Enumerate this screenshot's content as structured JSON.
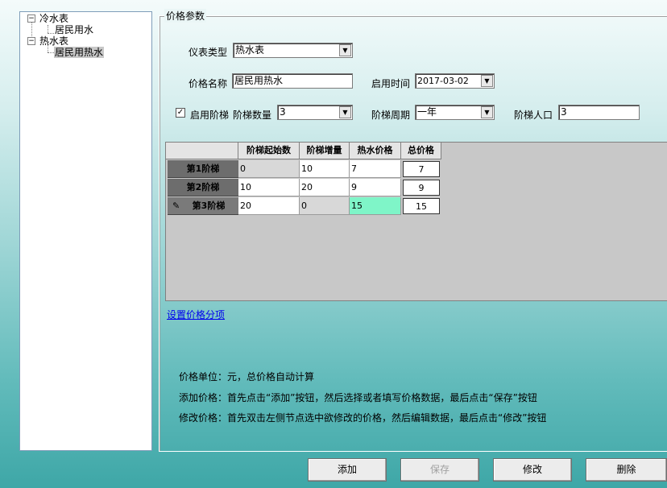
{
  "tree": {
    "nodes": [
      {
        "label": "冷水表",
        "expander": "−"
      },
      {
        "label": "居民用水"
      },
      {
        "label": "热水表",
        "expander": "−"
      },
      {
        "label": "居民用热水"
      }
    ]
  },
  "group": {
    "title": "价格参数"
  },
  "form": {
    "meter_type_label": "仪表类型",
    "meter_type_value": "热水表",
    "price_name_label": "价格名称",
    "price_name_value": "居民用热水",
    "start_time_label": "启用时间",
    "start_time_value": "2017-03-02",
    "enable_tier_label": "启用阶梯",
    "enable_tier_checked": "✓",
    "tier_count_label": "阶梯数量",
    "tier_count_value": "3",
    "tier_period_label": "阶梯周期",
    "tier_period_value": "一年",
    "tier_people_label": "阶梯人口",
    "tier_people_value": "3"
  },
  "grid": {
    "columns": [
      "阶梯起始数",
      "阶梯增量",
      "热水价格",
      "总价格"
    ],
    "rows": [
      {
        "header": "第1阶梯",
        "cells": [
          "0",
          "10",
          "7",
          "7"
        ]
      },
      {
        "header": "第2阶梯",
        "cells": [
          "10",
          "20",
          "9",
          "9"
        ]
      },
      {
        "header": "第3阶梯",
        "cells": [
          "20",
          "0",
          "15",
          "15"
        ]
      }
    ],
    "edit_marker": "✎"
  },
  "link": "设置价格分项",
  "notes": [
    "价格单位：元，总价格自动计算",
    "添加价格：首先点击“添加”按钮，然后选择或者填写价格数据，最后点击“保存”按钮",
    "修改价格：首先双击左侧节点选中欲修改的价格，然后编辑数据，最后点击“修改”按钮"
  ],
  "buttons": {
    "add": "添加",
    "save": "保存",
    "modify": "修改",
    "delete": "删除"
  }
}
